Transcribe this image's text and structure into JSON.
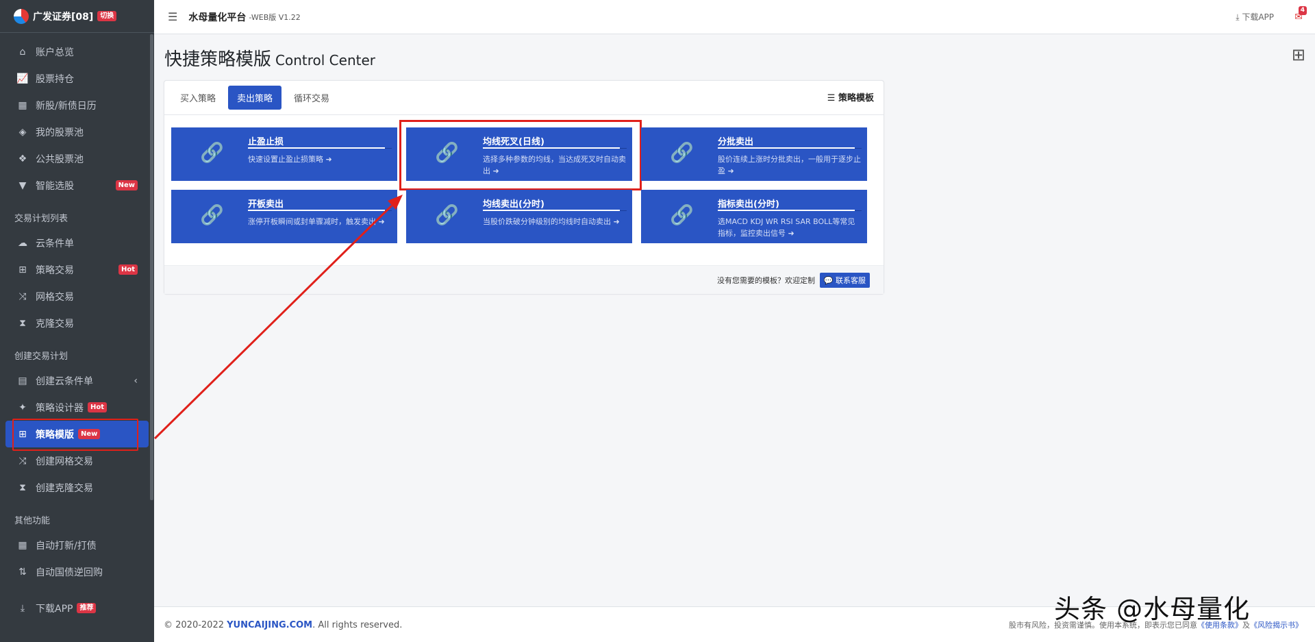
{
  "brand": {
    "name": "广发证券[08]",
    "switch_label": "切换"
  },
  "topbar": {
    "title": "水母量化平台",
    "version": "-WEB版 V1.22",
    "download": "下载APP",
    "mail_count": "4"
  },
  "sidebar": {
    "group1": [
      {
        "label": "账户总览",
        "icon": "home-icon"
      },
      {
        "label": "股票持仓",
        "icon": "chart-line-icon"
      },
      {
        "label": "新股/新债日历",
        "icon": "calendar-icon"
      },
      {
        "label": "我的股票池",
        "icon": "cube-icon"
      },
      {
        "label": "公共股票池",
        "icon": "cubes-icon"
      },
      {
        "label": "智能选股",
        "icon": "filter-icon",
        "badge": "New"
      }
    ],
    "head2": "交易计划列表",
    "group2": [
      {
        "label": "云条件单",
        "icon": "cloud-icon"
      },
      {
        "label": "策略交易",
        "icon": "sitemap-icon",
        "badge": "Hot"
      },
      {
        "label": "网格交易",
        "icon": "random-icon"
      },
      {
        "label": "克隆交易",
        "icon": "hourglass-icon"
      }
    ],
    "head3": "创建交易计划",
    "group3": [
      {
        "label": "创建云条件单",
        "icon": "file-icon"
      },
      {
        "label": "策略设计器",
        "icon": "magic-icon",
        "badge": "Hot"
      },
      {
        "label": "策略模版",
        "icon": "sitemap-icon",
        "badge": "New"
      },
      {
        "label": "创建网格交易",
        "icon": "random-icon"
      },
      {
        "label": "创建克隆交易",
        "icon": "hourglass-icon"
      }
    ],
    "head4": "其他功能",
    "group4": [
      {
        "label": "自动打新/打债",
        "icon": "calendar-grid-icon"
      },
      {
        "label": "自动国债逆回购",
        "icon": "sort-icon"
      },
      {
        "label": "下载APP",
        "icon": "download-icon",
        "badge": "推荐"
      }
    ]
  },
  "page": {
    "title": "快捷策略模版",
    "subtitle": "Control Center"
  },
  "tabs": [
    "买入策略",
    "卖出策略",
    "循环交易"
  ],
  "template_title": "策略模板",
  "tiles": [
    {
      "name": "止盈止损",
      "desc": "快速设置止盈止损策略"
    },
    {
      "name": "均线死叉(日线)",
      "desc": "选择多种参数的均线，当达成死叉时自动卖出"
    },
    {
      "name": "分批卖出",
      "desc": "股价连续上涨时分批卖出，一般用于逐步止盈"
    },
    {
      "name": "开板卖出",
      "desc": "涨停开板瞬间或封单骤减时，触发卖出"
    },
    {
      "name": "均线卖出(分时)",
      "desc": "当股价跌破分钟级别的均线时自动卖出"
    },
    {
      "name": "指标卖出(分时)",
      "desc": "选MACD KDJ WR RSI SAR BOLL等常见指标，监控卖出信号"
    }
  ],
  "card_footer": {
    "text": "没有您需要的模板？欢迎定制",
    "contact": "联系客服"
  },
  "footer": {
    "copy_prefix": "© 2020-2022 ",
    "copy_site": "YUNCAIJING.COM",
    "copy_suffix": ". All rights reserved.",
    "risk_prefix": "股市有风险，投资需谨慎。使用本系统，即表示您已同意",
    "terms": "《使用条款》",
    "and": "及",
    "risk_doc": "《风险揭示书》"
  },
  "watermark": "头条 @水母量化"
}
